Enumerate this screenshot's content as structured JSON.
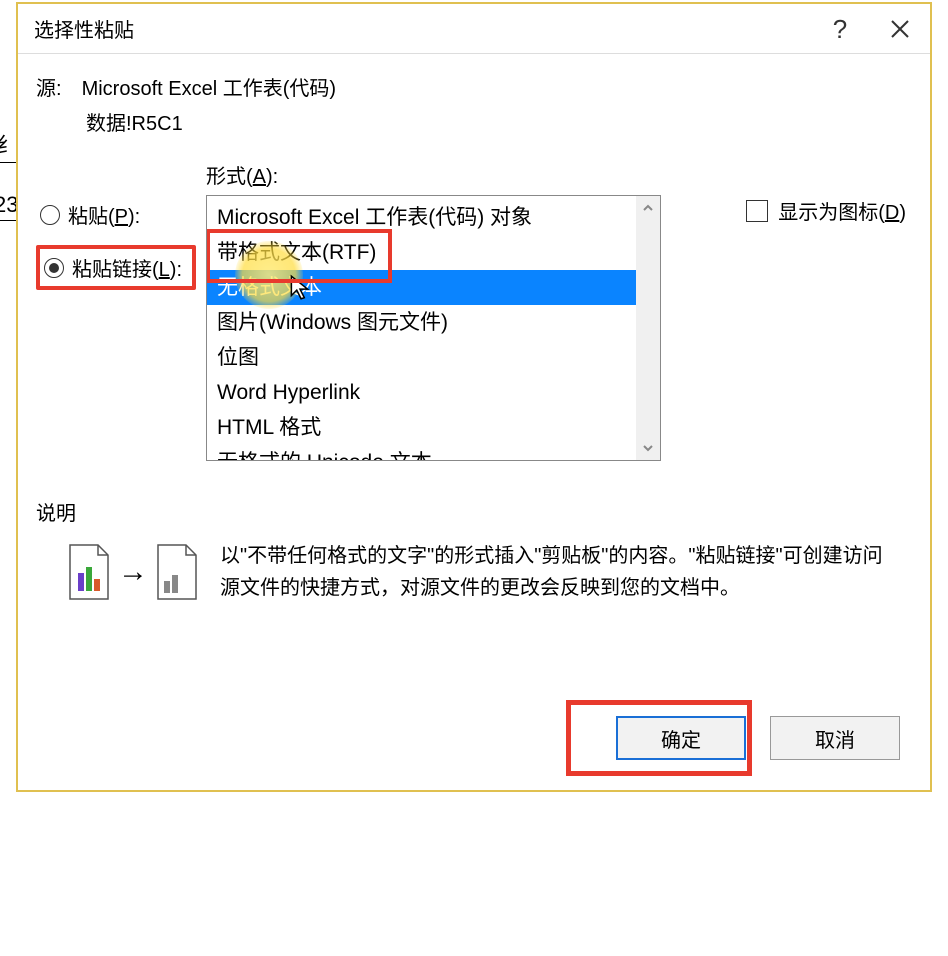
{
  "bg": {
    "frag1": "纟",
    "frag2": "23"
  },
  "dialog": {
    "title": "选择性粘贴",
    "source_label": "源:",
    "source_value": "Microsoft Excel 工作表(代码)",
    "source_sub": "数据!R5C1",
    "radios": {
      "paste_label": "粘贴",
      "paste_accel": "P",
      "pastelink_label": "粘贴链接",
      "pastelink_accel": "L"
    },
    "format_label": "形式",
    "format_accel": "A",
    "list": [
      "Microsoft Excel 工作表(代码) 对象",
      "带格式文本(RTF)",
      "无格式文本",
      "图片(Windows 图元文件)",
      "位图",
      "Word Hyperlink",
      "HTML 格式",
      "无格式的 Unicode 文本"
    ],
    "show_as_icon_label": "显示为图标",
    "show_as_icon_accel": "D",
    "desc_title": "说明",
    "desc_text": "以\"不带任何格式的文字\"的形式插入\"剪贴板\"的内容。\"粘贴链接\"可创建访问源文件的快捷方式，对源文件的更改会反映到您的文档中。",
    "arrow": "→",
    "ok_label": "确定",
    "cancel_label": "取消",
    "help_symbol": "?"
  }
}
